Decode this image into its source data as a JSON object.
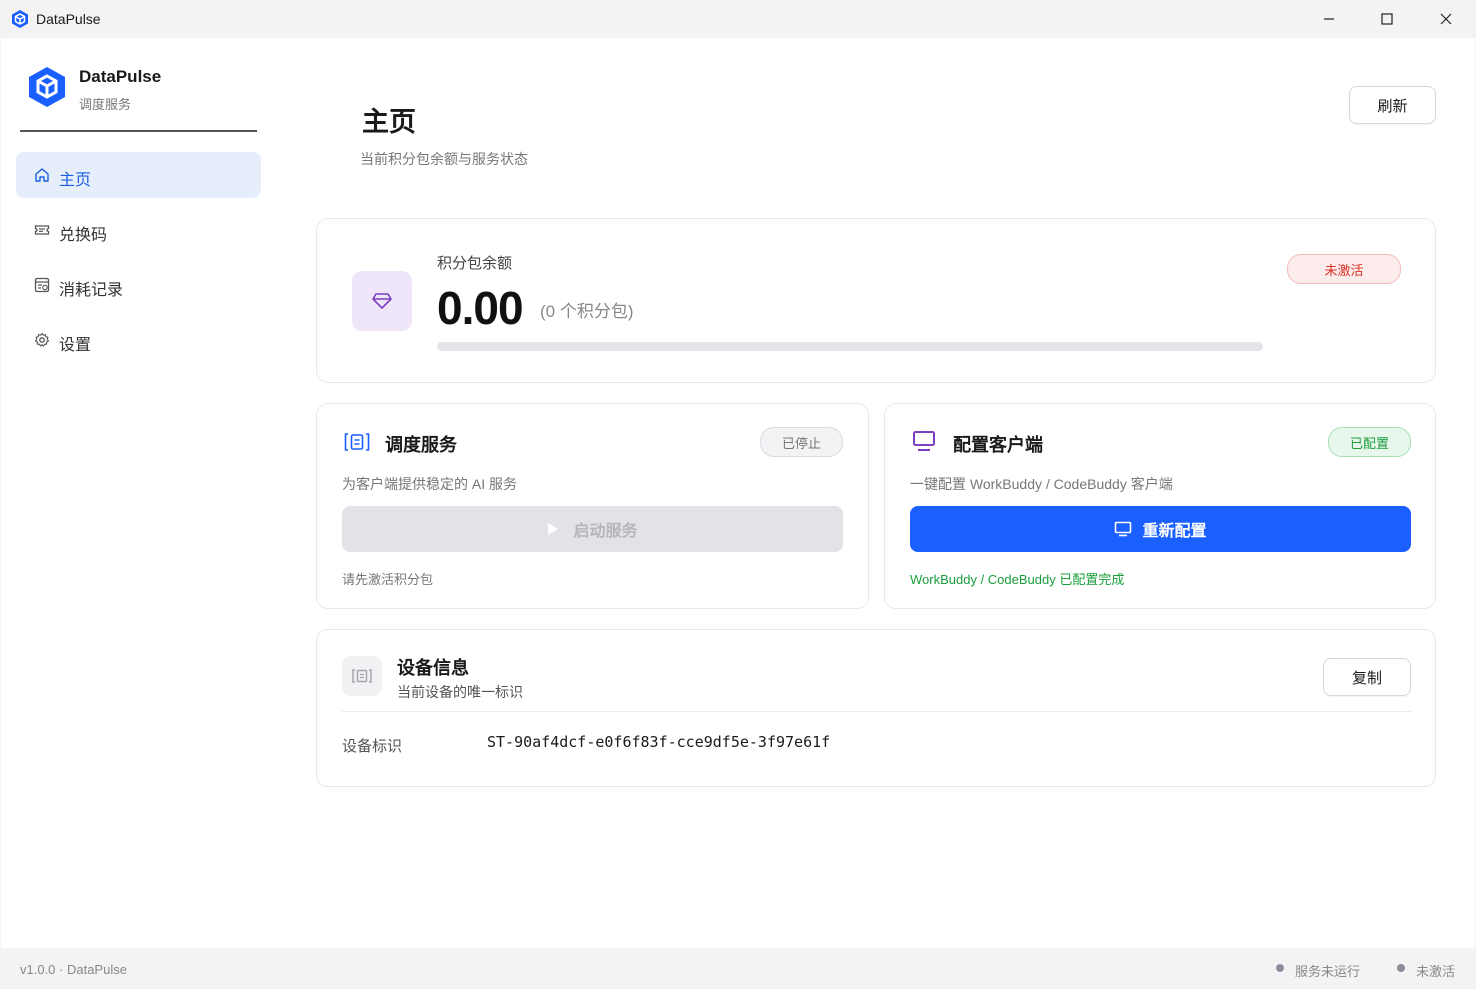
{
  "window": {
    "title": "DataPulse"
  },
  "sidebar": {
    "brand_name": "DataPulse",
    "brand_sub": "调度服务",
    "items": [
      {
        "label": "主页",
        "icon": "home-icon",
        "active": true
      },
      {
        "label": "兑换码",
        "icon": "ticket-icon",
        "active": false
      },
      {
        "label": "消耗记录",
        "icon": "record-icon",
        "active": false
      },
      {
        "label": "设置",
        "icon": "gear-icon",
        "active": false
      }
    ]
  },
  "header": {
    "title": "主页",
    "subtitle": "当前积分包余额与服务状态",
    "refresh_label": "刷新"
  },
  "balance": {
    "label": "积分包余额",
    "value": "0.00",
    "count_text": "(0 个积分包)",
    "progress": 0,
    "status": "未激活",
    "icon": "diamond-icon"
  },
  "schedule": {
    "title": "调度服务",
    "status": "已停止",
    "desc": "为客户端提供稳定的 AI 服务",
    "button_label": "启动服务",
    "hint": "请先激活积分包",
    "icon": "schedule-icon"
  },
  "config": {
    "title": "配置客户端",
    "status": "已配置",
    "desc": "一键配置 WorkBuddy / CodeBuddy 客户端",
    "button_label": "重新配置",
    "hint": "WorkBuddy / CodeBuddy 已配置完成",
    "icon": "monitor-icon"
  },
  "device": {
    "title": "设备信息",
    "subtitle": "当前设备的唯一标识",
    "copy_label": "复制",
    "id_label": "设备标识",
    "id_value": "ST-90af4dcf-e0f6f83f-cce9df5e-3f97e61f",
    "icon": "chip-icon"
  },
  "statusbar": {
    "version": "v1.0.0 · DataPulse",
    "service_status": "服务未运行",
    "activation_status": "未激活"
  },
  "colors": {
    "accent": "#1a5fff",
    "danger": "#d93025",
    "success": "#1a9d3c",
    "muted": "#8a8f99",
    "purple": "#7b3fbf"
  }
}
